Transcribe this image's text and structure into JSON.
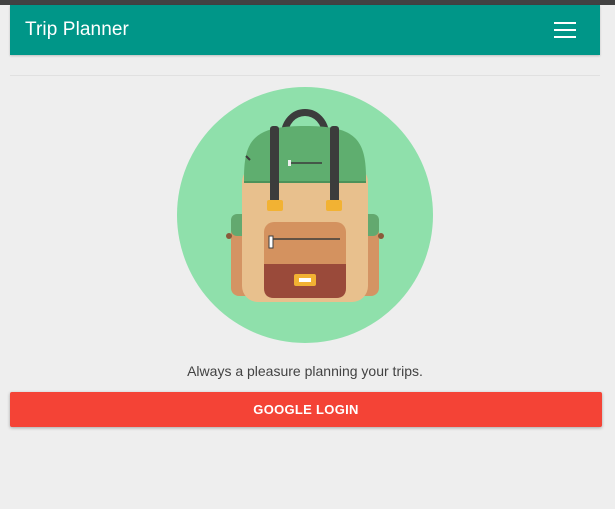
{
  "app_bar": {
    "title": "Trip Planner",
    "menu_icon": "hamburger-menu-icon"
  },
  "hero": {
    "image": "backpack-illustration",
    "tagline": "Always a pleasure planning your trips."
  },
  "actions": {
    "login_label": "GOOGLE LOGIN"
  },
  "colors": {
    "app_bar": "#009688",
    "background": "#eeeeee",
    "login_button": "#f44336",
    "illustration_circle": "#8fe0ab"
  }
}
